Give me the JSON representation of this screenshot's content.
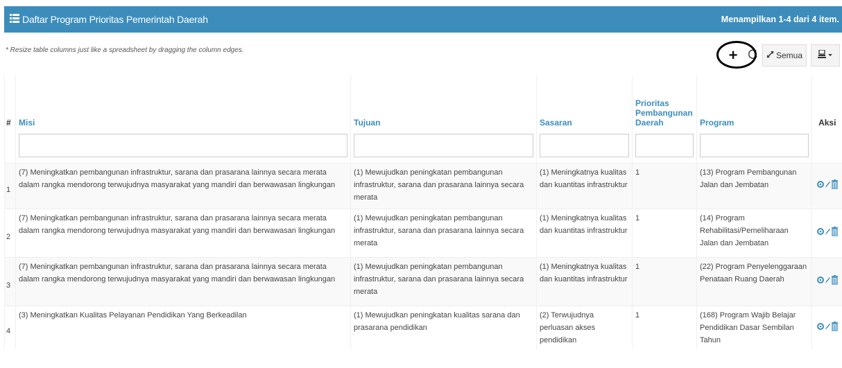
{
  "header": {
    "title": "Daftar Program Prioritas Pemerintah Daerah",
    "summary": "Menampilkan 1-4 dari 4 item."
  },
  "hint": "* Resize table columns just like a spreadsheet by dragging the column edges.",
  "toolbar": {
    "add_label": "+",
    "refresh_icon": "refresh-icon",
    "semua_label": "Semua",
    "export_icon": "export-icon"
  },
  "columns": {
    "hash": "#",
    "misi": "Misi",
    "tujuan": "Tujuan",
    "sasaran": "Sasaran",
    "prioritas": "Prioritas Pembangunan Daerah",
    "program": "Program",
    "aksi": "Aksi"
  },
  "rows": [
    {
      "no": "1",
      "misi": "(7) Meningkatkan pembangunan infrastruktur, sarana dan prasarana lainnya secara merata dalam rangka mendorong terwujudnya masyarakat yang mandiri dan berwawasan lingkungan",
      "tujuan": "(1) Mewujudkan peningkatan pembangunan infrastruktur, sarana dan prasarana lainnya secara merata",
      "sasaran": "(1) Meningkatnya kualitas dan kuantitas infrastruktur",
      "prioritas": "1",
      "program": "(13) Program Pembangunan Jalan dan Jembatan"
    },
    {
      "no": "2",
      "misi": "(7) Meningkatkan pembangunan infrastruktur, sarana dan prasarana lainnya secara merata dalam rangka mendorong terwujudnya masyarakat yang mandiri dan berwawasan lingkungan",
      "tujuan": "(1) Mewujudkan peningkatan pembangunan infrastruktur, sarana dan prasarana lainnya secara merata",
      "sasaran": "(1) Meningkatnya kualitas dan kuantitas infrastruktur",
      "prioritas": "1",
      "program": "(14) Program Rehabilitasi/Pemeliharaan Jalan dan Jembatan"
    },
    {
      "no": "3",
      "misi": "(7) Meningkatkan pembangunan infrastruktur, sarana dan prasarana lainnya secara merata dalam rangka mendorong terwujudnya masyarakat yang mandiri dan berwawasan lingkungan",
      "tujuan": "(1) Mewujudkan peningkatan pembangunan infrastruktur, sarana dan prasarana lainnya secara merata",
      "sasaran": "(1) Meningkatnya kualitas dan kuantitas infrastruktur",
      "prioritas": "1",
      "program": "(22) Program Penyelenggaraan Penataan Ruang Daerah"
    },
    {
      "no": "4",
      "misi": "(3) Meningkatkan Kualitas Pelayanan Pendidikan Yang Berkeadilan",
      "tujuan": "(1) Mewujudkan peningkatan kualitas sarana dan prasarana pendidikan",
      "sasaran": "(2) Terwujudnya perluasan akses pendidikan",
      "prioritas": "1",
      "program": "(168) Program Wajib Belajar Pendidikan Dasar Sembilan Tahun"
    }
  ],
  "colors": {
    "header_bg": "#3c8dbc",
    "link": "#3c8dbc",
    "action_icon": "#3c8dbc"
  },
  "row_actions": [
    "view-icon",
    "edit-icon",
    "delete-icon"
  ]
}
